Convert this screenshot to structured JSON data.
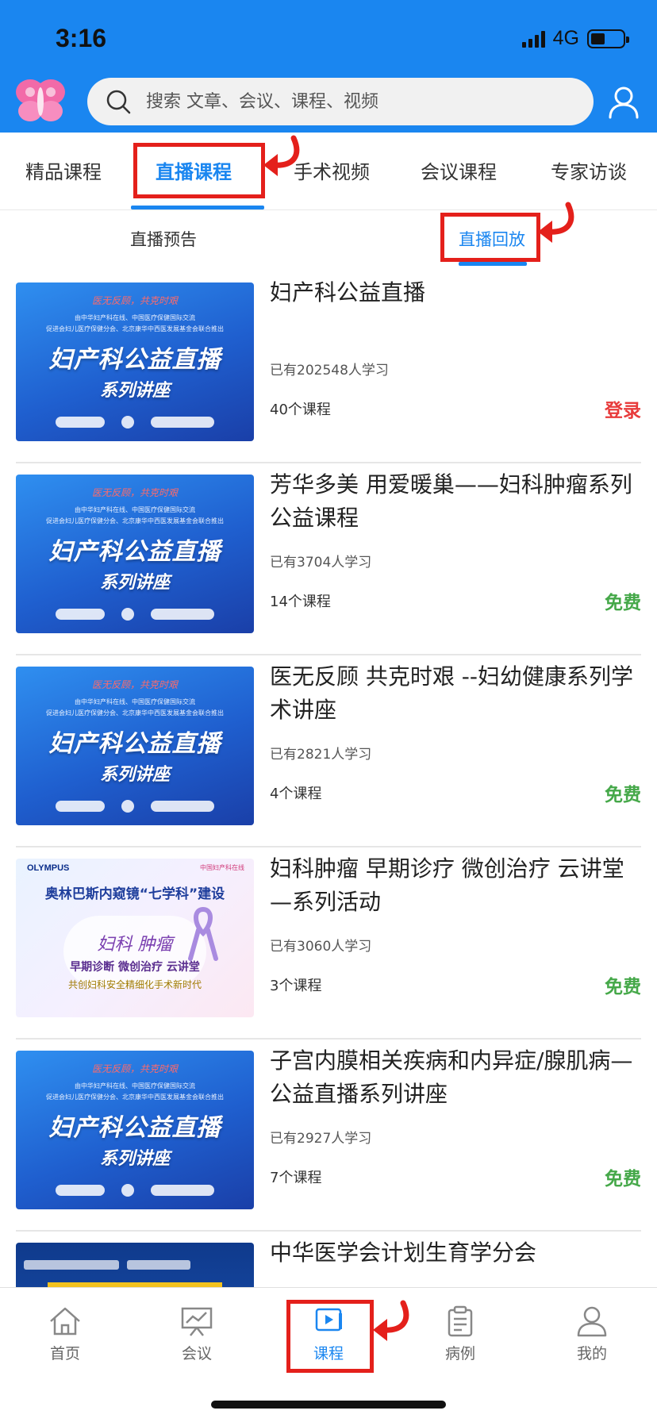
{
  "status_bar": {
    "time": "3:16",
    "network": "4G",
    "battery_level": 0.46
  },
  "header": {
    "search_placeholder": "搜索 文章、会议、课程、视频",
    "logo_icon": "butterfly-logo-icon",
    "brand_color": "#1a86f0"
  },
  "main_tabs": [
    {
      "label": "精品课程",
      "active": false
    },
    {
      "label": "直播课程",
      "active": true
    },
    {
      "label": "手术视频",
      "active": false
    },
    {
      "label": "会议课程",
      "active": false
    },
    {
      "label": "专家访谈",
      "active": false
    }
  ],
  "sub_tabs": [
    {
      "label": "直播预告",
      "active": false
    },
    {
      "label": "直播回放",
      "active": true
    }
  ],
  "thumb_text": {
    "slogan": "医无反顾，共克时艰",
    "organizers": "由中华妇产科在线、中国医疗保健国际交流\n促进会妇儿医疗保健分会、北京康华中西医发展基金会联合推出",
    "main_title": "妇产科公益直播",
    "series": "系列讲座",
    "olympus_brand": "OLYMPUS",
    "olympus_org": "中国妇产科在线",
    "olympus_title": "奥林巴斯内窥镜“七学科”建设",
    "olympus_name": "妇科 肿瘤",
    "olympus_line1": "早期诊断 微创治疗 云讲堂",
    "olympus_line2": "共创妇科安全精细化手术新时代"
  },
  "courses": [
    {
      "title": "妇产科公益直播",
      "learners": "已有202548人学习",
      "count": "40个课程",
      "price": "登录",
      "price_color": "#e83a3a"
    },
    {
      "title": "芳华多美 用爱暖巢——妇科肿瘤系列公益课程",
      "learners": "已有3704人学习",
      "count": "14个课程",
      "price": "免费",
      "price_color": "#45a849"
    },
    {
      "title": "医无反顾 共克时艰 --妇幼健康系列学术讲座",
      "learners": "已有2821人学习",
      "count": "4个课程",
      "price": "免费",
      "price_color": "#45a849"
    },
    {
      "title": "妇科肿瘤 早期诊疗 微创治疗 云讲堂—系列活动",
      "learners": "已有3060人学习",
      "count": "3个课程",
      "price": "免费",
      "price_color": "#45a849"
    },
    {
      "title": "子宫内膜相关疾病和内异症/腺肌病—公益直播系列讲座",
      "learners": "已有2927人学习",
      "count": "7个课程",
      "price": "免费",
      "price_color": "#45a849"
    },
    {
      "title": "中华医学会计划生育学分会",
      "learners": "",
      "count": "",
      "price": "",
      "price_color": "#45a849"
    }
  ],
  "bottom_nav": [
    {
      "label": "首页",
      "icon": "home-icon",
      "active": false
    },
    {
      "label": "会议",
      "icon": "meeting-board-icon",
      "active": false
    },
    {
      "label": "课程",
      "icon": "course-play-icon",
      "active": true
    },
    {
      "label": "病例",
      "icon": "clipboard-icon",
      "active": false
    },
    {
      "label": "我的",
      "icon": "profile-icon",
      "active": false
    }
  ]
}
